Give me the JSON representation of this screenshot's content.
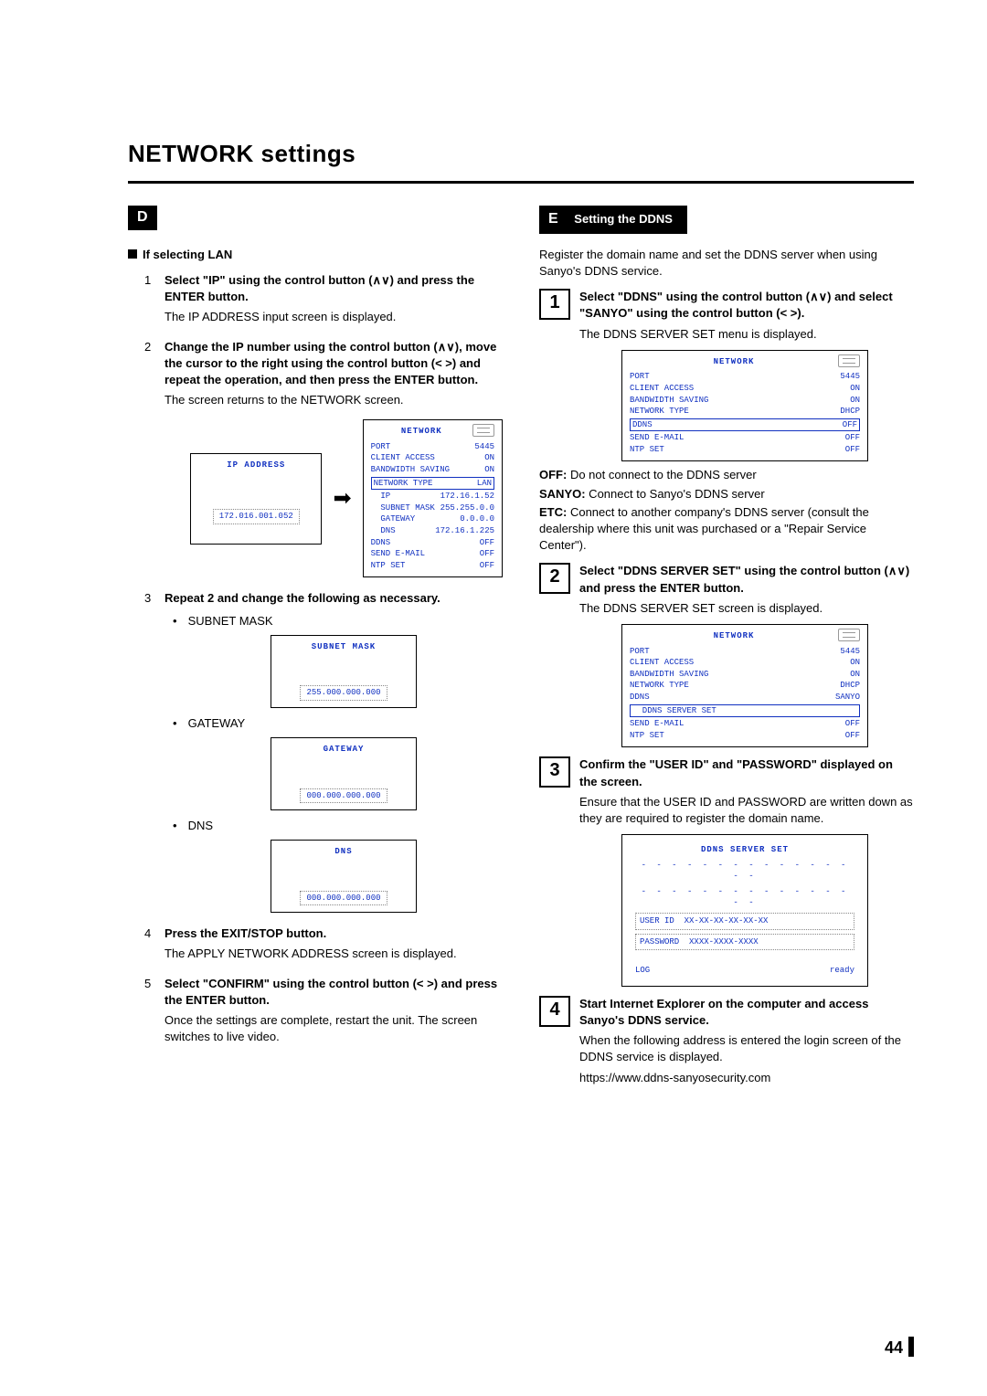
{
  "page": {
    "title": "NETWORK settings",
    "number": "44"
  },
  "left": {
    "section_letter": "D",
    "subhead": "If selecting LAN",
    "steps": {
      "s1": {
        "num": "1",
        "lead": "Select \"IP\" using the control button (∧∨) and press the ENTER button.",
        "body": "The IP ADDRESS input screen is displayed."
      },
      "s2": {
        "num": "2",
        "lead": "Change the IP number using the control button (∧∨), move the cursor to the right using the control button (< >) and repeat the operation, and then press the ENTER button.",
        "body": "The screen returns to the NETWORK screen."
      },
      "s3": {
        "num": "3",
        "lead_a": "Repeat ",
        "lead_b": "2",
        "lead_c": " and change the following as necessary.",
        "bullets": {
          "subnet": "SUBNET MASK",
          "gateway": "GATEWAY",
          "dns": "DNS"
        }
      },
      "s4": {
        "num": "4",
        "lead": "Press the EXIT/STOP button.",
        "body": "The APPLY NETWORK ADDRESS screen is displayed."
      },
      "s5": {
        "num": "5",
        "lead": "Select \"CONFIRM\" using the control button (< >) and press the ENTER button.",
        "body": "Once the settings are complete, restart the unit. The screen switches to live video."
      }
    },
    "osd_ip": {
      "title": "IP ADDRESS",
      "value": "172.016.001.052"
    },
    "osd_net": {
      "title": "NETWORK",
      "rows": [
        [
          "PORT",
          "5445"
        ],
        [
          "CLIENT ACCESS",
          "ON"
        ],
        [
          "BANDWIDTH SAVING",
          "ON"
        ],
        [
          "NETWORK TYPE",
          "LAN"
        ],
        [
          "  IP",
          "172.16.1.52"
        ],
        [
          "  SUBNET MASK",
          "255.255.0.0"
        ],
        [
          "  GATEWAY",
          "0.0.0.0"
        ],
        [
          "  DNS",
          "172.16.1.225"
        ],
        [
          "DDNS",
          "OFF"
        ],
        [
          "SEND E-MAIL",
          "OFF"
        ],
        [
          "NTP SET",
          "OFF"
        ]
      ]
    },
    "osd_subnet": {
      "title": "SUBNET MASK",
      "value": "255.000.000.000"
    },
    "osd_gateway": {
      "title": "GATEWAY",
      "value": "000.000.000.000"
    },
    "osd_dns": {
      "title": "DNS",
      "value": "000.000.000.000"
    }
  },
  "right": {
    "section_letter": "E",
    "section_title": "Setting the DDNS",
    "intro": "Register the domain name and set the DDNS server when using Sanyo's DDNS service.",
    "step1": {
      "num": "1",
      "lead": "Select \"DDNS\" using the control button (∧∨) and select \"SANYO\" using the control button (< >).",
      "body": "The DDNS SERVER SET menu is displayed."
    },
    "osd1": {
      "title": "NETWORK",
      "rows": [
        [
          "PORT",
          "5445"
        ],
        [
          "CLIENT ACCESS",
          "ON"
        ],
        [
          "BANDWIDTH SAVING",
          "ON"
        ],
        [
          "NETWORK TYPE",
          "DHCP"
        ]
      ],
      "sel": [
        "DDNS",
        "OFF"
      ],
      "rows2": [
        [
          "SEND E-MAIL",
          "OFF"
        ],
        [
          "NTP SET",
          "OFF"
        ]
      ]
    },
    "defs": {
      "off_t": "OFF:",
      "off_d": " Do not connect to the DDNS server",
      "sanyo_t": "SANYO:",
      "sanyo_d": " Connect to Sanyo's DDNS server",
      "etc_t": "ETC:",
      "etc_d": " Connect to another company's DDNS server (consult the dealership where this unit was purchased or a \"Repair Service Center\")."
    },
    "step2": {
      "num": "2",
      "lead": "Select \"DDNS SERVER SET\" using the control button (∧∨) and press the ENTER button.",
      "body": "The DDNS SERVER SET screen is displayed."
    },
    "osd2": {
      "title": "NETWORK",
      "rows": [
        [
          "PORT",
          "5445"
        ],
        [
          "CLIENT ACCESS",
          "ON"
        ],
        [
          "BANDWIDTH SAVING",
          "ON"
        ],
        [
          "NETWORK TYPE",
          "DHCP"
        ],
        [
          "DDNS",
          "SANYO"
        ]
      ],
      "sel": [
        "  DDNS SERVER SET",
        ""
      ],
      "rows2": [
        [
          "SEND E-MAIL",
          "OFF"
        ],
        [
          "NTP SET",
          "OFF"
        ]
      ]
    },
    "step3": {
      "num": "3",
      "lead": "Confirm the \"USER ID\" and \"PASSWORD\" displayed on the screen.",
      "body": "Ensure that the USER ID and PASSWORD are written down as they are required to register the domain name."
    },
    "osd3": {
      "title": "DDNS SERVER SET",
      "dashes": "- - - - - - - - - - - - - - - -",
      "user_l": "USER ID",
      "user_v": "XX-XX-XX-XX-XX-XX",
      "pass_l": "PASSWORD",
      "pass_v": "XXXX-XXXX-XXXX",
      "log": "LOG",
      "ready": "ready"
    },
    "step4": {
      "num": "4",
      "lead": "Start Internet Explorer on the computer and access Sanyo's DDNS service.",
      "body": "When the following address is entered the login screen of the DDNS service is displayed.",
      "url": "https://www.ddns-sanyosecurity.com"
    }
  }
}
